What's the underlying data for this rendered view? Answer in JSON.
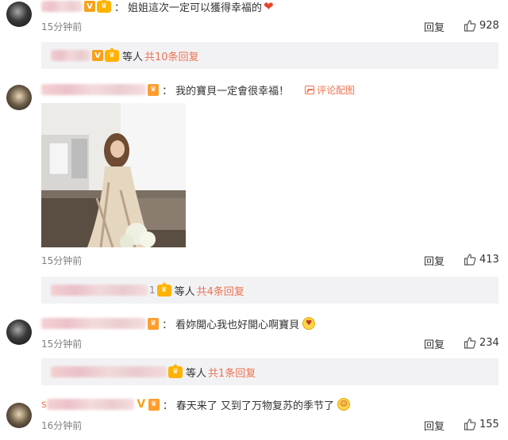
{
  "comments": [
    {
      "text": "姐姐這次一定可以獲得幸福的",
      "time": "15分钟前",
      "reply_label": "回复",
      "likes": "928",
      "replies_bar": {
        "who": "等人",
        "total": "共10条回复"
      }
    },
    {
      "text": "我的寶貝一定會很幸福！",
      "flag_label": "评论配图",
      "time": "15分钟前",
      "reply_label": "回复",
      "likes": "413",
      "replies_bar": {
        "name_suffix": "1",
        "who": "等人",
        "total": "共4条回复"
      }
    },
    {
      "text": "看妳開心我也好開心啊寶貝",
      "time": "15分钟前",
      "reply_label": "回复",
      "likes": "234",
      "replies_bar": {
        "who": "等人",
        "total": "共1条回复"
      }
    },
    {
      "name_prefix": "s",
      "text": "春天来了 又到了万物复苏的季节了",
      "time": "16分钟前",
      "reply_label": "回复",
      "likes": "155"
    }
  ],
  "colors": {
    "accent": "#eb7350",
    "vip": "#f7a21b",
    "reply_bg": "#f2f2f5",
    "muted": "#808080"
  },
  "icons": [
    "avatar",
    "vip-v-icon",
    "crown-badge-icon",
    "heart-emoji-icon",
    "picture-icon",
    "thumbs-up-icon",
    "smiley-emoji-icon"
  ]
}
